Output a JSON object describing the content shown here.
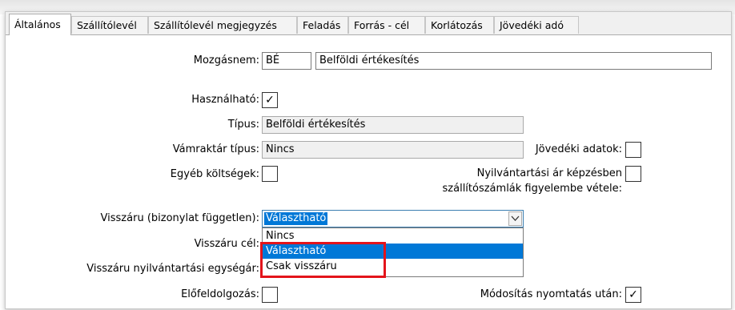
{
  "tabs": [
    {
      "label": "Általános",
      "active": true
    },
    {
      "label": "Szállítólevél",
      "active": false
    },
    {
      "label": "Szállítólevél megjegyzés",
      "active": false
    },
    {
      "label": "Feladás",
      "active": false
    },
    {
      "label": "Forrás - cél",
      "active": false
    },
    {
      "label": "Korlátozás",
      "active": false
    },
    {
      "label": "Jövedéki adó",
      "active": false
    }
  ],
  "form": {
    "mozgasnem_label": "Mozgásnem:",
    "mozgasnem_code": "BÉ",
    "mozgasnem_name": "Belföldi értékesítés",
    "hasznalhato_label": "Használható:",
    "hasznalhato_checked": "✓",
    "tipus_label": "Típus:",
    "tipus_value": "Belföldi értékesítés",
    "vamraktar_label": "Vámraktár típus:",
    "vamraktar_value": "Nincs",
    "jovedeki_label": "Jövedéki adatok:",
    "egyeb_label": "Egyéb költségek:",
    "nyilv_label_line1": "Nyilvántartási ár képzésben",
    "nyilv_label_line2": "szállítószámlák figyelembe vétele:",
    "visszaru_label": "Visszáru (bizonylat független):",
    "visszaru_value": "Választható",
    "visszaru_cel_label": "Visszáru cél:",
    "visszaru_egyseg_label": "Visszáru nyilvántartási egységár:",
    "elofeldolgozas_label": "Előfeldolgozás:",
    "modositas_label": "Módosítás nyomtatás után:",
    "modositas_checked": "✓"
  },
  "dropdown": {
    "options": [
      "Nincs",
      "Választható",
      "Csak visszáru"
    ],
    "highlighted": "Választható"
  },
  "icons": {
    "combo_arrow": "chevron-down-icon"
  },
  "colors": {
    "selection": "#0078d7",
    "highlight_box": "#e3141b"
  }
}
